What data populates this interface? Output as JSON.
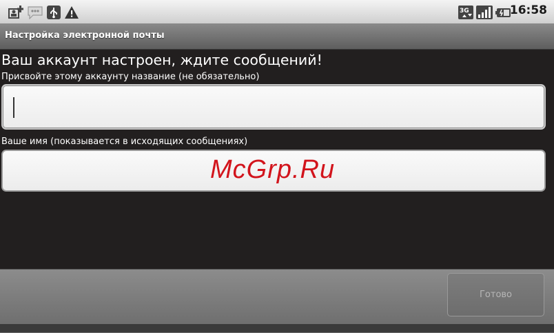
{
  "status_bar": {
    "time": "16:58",
    "network_badge": "3G",
    "icons_left": [
      "add-user-icon",
      "message-icon",
      "usb-icon",
      "warning-icon"
    ],
    "icons_right": [
      "network-3g-icon",
      "signal-icon",
      "battery-icon"
    ]
  },
  "title_bar": {
    "title": "Настройка электронной почты"
  },
  "content": {
    "headline": "Ваш аккаунт настроен, ждите сообщений!",
    "account_name_label": "Присвойте этому аккаунту название (не обязательно)",
    "account_name_value": "",
    "your_name_label": "Ваше имя (показывается в исходящих сообщениях)",
    "your_name_value": "",
    "watermark": "McGrp.Ru"
  },
  "footer": {
    "done_label": "Готово"
  },
  "colors": {
    "background": "#221f1f",
    "watermark": "#d2141c",
    "done_text_disabled": "#b7b7b7"
  }
}
